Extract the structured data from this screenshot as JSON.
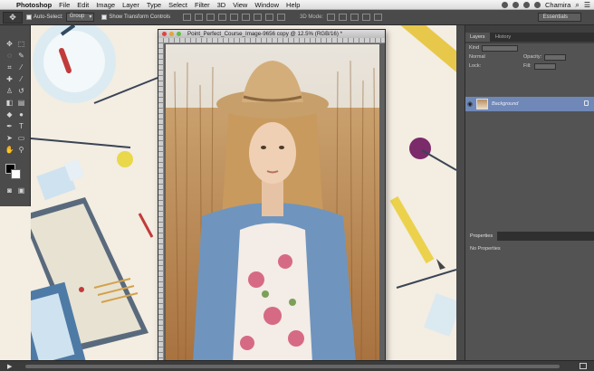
{
  "menubar": {
    "app_name": "Photoshop",
    "items": [
      "File",
      "Edit",
      "Image",
      "Layer",
      "Type",
      "Select",
      "Filter",
      "3D",
      "View",
      "Window",
      "Help"
    ],
    "user": "Chamira"
  },
  "options_bar": {
    "auto_select_label": "Auto-Select:",
    "auto_select_value": "Group",
    "show_transform_label": "Show Transform Controls",
    "mode_label": "3D Mode:",
    "workspace": "Essentials"
  },
  "document": {
    "title": "Point_Perfect_Course_Image-9656 copy @ 12.5% (RGB/16) *"
  },
  "layers_panel": {
    "tabs": [
      "Layers",
      "History"
    ],
    "kind_label": "Kind",
    "blend_mode": "Normal",
    "opacity_label": "Opacity:",
    "lock_label": "Lock:",
    "fill_label": "Fill:",
    "layer_name": "Background"
  },
  "properties_panel": {
    "tab": "Properties",
    "message": "No Properties"
  },
  "colors": {
    "selection": "#6f88b7",
    "panel": "#535353",
    "desk": "#f3ede2"
  },
  "icons": [
    "apple-icon",
    "move-tool-icon",
    "eye-icon",
    "lock-icon",
    "wifi-icon",
    "search-icon",
    "play-icon",
    "fullscreen-icon"
  ]
}
